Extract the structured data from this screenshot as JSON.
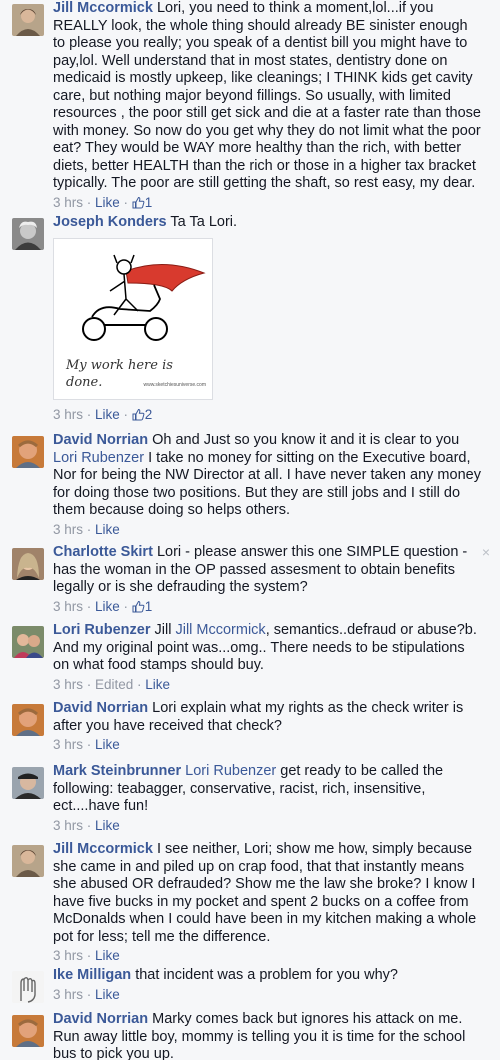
{
  "comments": [
    {
      "author": "Jill Mccormick",
      "mention": "",
      "text": "Lori, you need to think a moment,lol...if you REALLY look, the whole thing should already BE sinister enough to please you really; you speak of a dentist bill you might have to pay,lol. Well understand that in most states, dentistry done on medicaid is mostly upkeep, like cleanings; I THINK kids get cavity care, but nothing major beyond fillings. So usually, with limited resources , the poor still get sick and die at a faster rate than those with money. So now do you get why they do not limit what the poor eat? They would be WAY more healthy than the rich, with better diets, better HEALTH than the rich or those in a higher tax bracket typically. The poor are still getting the shaft, so rest easy, my dear.",
      "time": "3 hrs",
      "edited": "",
      "like": "Like",
      "likes": "1"
    },
    {
      "author": "Joseph Konders",
      "mention": "",
      "text": "Ta Ta Lori.",
      "attachment_caption": "My work here is done.",
      "attachment_credit": "www.sketchiesuniverse.com",
      "time": "3 hrs",
      "edited": "",
      "like": "Like",
      "likes": "2"
    },
    {
      "author": "David Norrian",
      "mention": "",
      "text_before": "Oh and Just so you know it and it is clear to you",
      "mention_mid": "Lori Rubenzer",
      "text": "I take no money for sitting on the Executive board, Nor for being the NW Director at all. I have never taken any money for doing those two positions. But they are still jobs and I still do them because doing so helps others.",
      "time": "3 hrs",
      "edited": "",
      "like": "Like",
      "likes": ""
    },
    {
      "author": "Charlotte Skirt",
      "mention": "",
      "text": "Lori - please answer this one SIMPLE question - has the woman in the OP passed assesment to obtain benefits legally or is she defrauding the system?",
      "time": "3 hrs",
      "edited": "",
      "like": "Like",
      "likes": "1",
      "close": "×"
    },
    {
      "author": "Lori Rubenzer",
      "mention": "Jill Mccormick",
      "text_before": "Jill",
      "text": ", semantics..defraud or abuse?b. And my original point was...omg.. There needs to be stipulations on what food stamps should buy.",
      "time": "3 hrs",
      "edited": "Edited",
      "like": "Like",
      "likes": ""
    },
    {
      "author": "David Norrian",
      "mention": "",
      "text": "Lori explain what my rights as the check writer is after you have received that check?",
      "time": "3 hrs",
      "edited": "",
      "like": "Like",
      "likes": ""
    },
    {
      "author": "Mark Steinbrunner",
      "mention": "Lori Rubenzer",
      "text": "get ready to be called the following: teabagger, conservative, racist, rich, insensitive, ect....have fun!",
      "time": "3 hrs",
      "edited": "",
      "like": "Like",
      "likes": ""
    },
    {
      "author": "Jill Mccormick",
      "mention": "",
      "text": "I see neither, Lori; show me how, simply because she came in and piled up on crap food, that that instantly means she abused OR defrauded? Show me the law she broke? I know I have five bucks in my pocket and spent 2 bucks on a coffee from McDonalds when I could have been in my kitchen making a whole pot for less; tell me the difference.",
      "time": "3 hrs",
      "edited": "",
      "like": "Like",
      "likes": ""
    },
    {
      "author": "Ike Milligan",
      "mention": "",
      "text": "that incident was a problem for you why?",
      "time": "3 hrs",
      "edited": "",
      "like": "Like",
      "likes": ""
    },
    {
      "author": "David Norrian",
      "mention": "",
      "text": "Marky comes back but ignores his attack on me. Run away little boy, mommy is telling you it is time for the school bus to pick you up.",
      "time": "",
      "edited": "",
      "like": "",
      "likes": ""
    }
  ],
  "colors": {
    "link": "#3b5998",
    "meta": "#9197a3",
    "background": "#f6f7f9"
  },
  "icons": {
    "like_count": "thumbs-up-outline-icon",
    "dismiss": "close-icon"
  }
}
